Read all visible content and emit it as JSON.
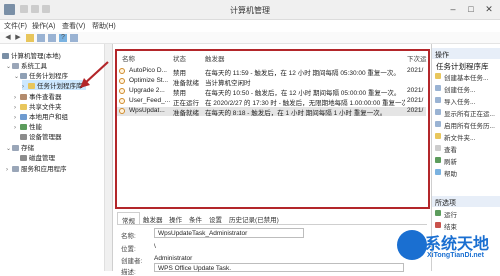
{
  "window": {
    "title": "计算机管理"
  },
  "menu": [
    "文件(F)",
    "操作(A)",
    "查看(V)",
    "帮助(H)"
  ],
  "tree": {
    "root": "计算机管理(本地)",
    "items": [
      {
        "label": "系统工具"
      },
      {
        "label": "任务计划程序"
      },
      {
        "label": "任务计划程序库"
      },
      {
        "label": "事件查看器"
      },
      {
        "label": "共享文件夹"
      },
      {
        "label": "本地用户和组"
      },
      {
        "label": "性能"
      },
      {
        "label": "设备管理器"
      },
      {
        "label": "存储"
      },
      {
        "label": "磁盘管理"
      },
      {
        "label": "服务和应用程序"
      }
    ]
  },
  "task_table": {
    "columns": [
      "名称",
      "状态",
      "触发器",
      "下次运"
    ],
    "rows": [
      {
        "name": "AutoPico D...",
        "status": "禁用",
        "trigger": "在每天的 11:59 - 触发后，在 12 小时 期间每隔 05:30:00 重复一次。",
        "next": "2021/"
      },
      {
        "name": "Optimize St...",
        "status": "准备就绪",
        "trigger": "当计算机空闲时",
        "next": ""
      },
      {
        "name": "Upgrade 2...",
        "status": "禁用",
        "trigger": "在每天的 10:50 - 触发后，在 12 小时 期间每隔 05:00:00 重复一次。",
        "next": "2021/"
      },
      {
        "name": "User_Feed_...",
        "status": "正在运行",
        "trigger": "在 2020/2/27 的 17:30 时 - 触发后，无限期地每隔 1.00:00:00 重复一次。",
        "next": "2021/"
      },
      {
        "name": "WpsUpdat...",
        "status": "准备就绪",
        "trigger": "在每天的 8:18 - 触发后，在 1 小时 期间每隔 1 小时 重复一次。",
        "next": "2021/"
      }
    ]
  },
  "detail_tabs": [
    "常规",
    "触发器",
    "操作",
    "条件",
    "设置",
    "历史记录(已禁用)"
  ],
  "detail": {
    "name_label": "名称:",
    "name_value": "WpsUpdateTask_Administrator",
    "location_label": "位置:",
    "location_value": "\\",
    "author_label": "创建者:",
    "author_value": "Administrator",
    "desc_label": "描述:",
    "desc_value": "WPS Office Update Task."
  },
  "actions": {
    "header": "操作",
    "section1_title": "任务计划程序库",
    "section1_items": [
      "创建基本任务...",
      "创建任务...",
      "导入任务...",
      "显示所有正在运...",
      "启用所有任务历...",
      "新文件夹...",
      "查看",
      "刷新",
      "帮助"
    ],
    "section2_title": "所选项",
    "section2_items": [
      "运行",
      "结束"
    ]
  },
  "watermark": {
    "text": "系统天地",
    "url": "XiTongTianDi.net"
  },
  "colors": {
    "highlight_box": "#b3262a",
    "selection": "#cce8ff",
    "watermark": "#1a6fd1"
  }
}
